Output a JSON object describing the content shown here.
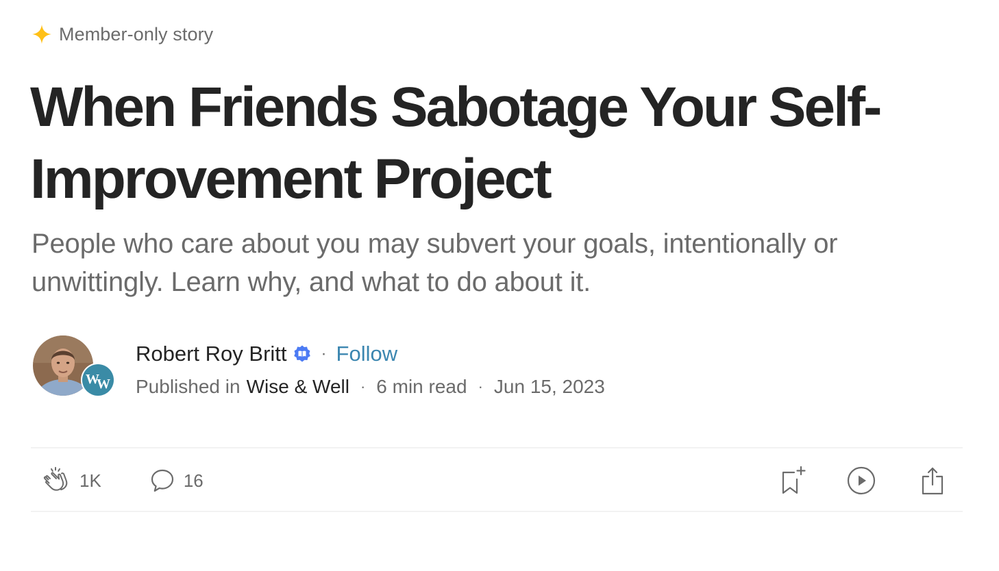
{
  "member_badge": {
    "icon": "sparkle-star-icon",
    "label": "Member-only story",
    "star_color": "#FFC017"
  },
  "article": {
    "title": "When Friends Sabotage Your Self-Improvement Project",
    "subtitle": "People who care about you may subvert your goals, intentionally or unwittingly. Learn why, and what to do about it."
  },
  "author": {
    "name": "Robert Roy Britt",
    "verified_icon": "verified-badge-icon",
    "follow_label": "Follow",
    "avatar_icon": "author-avatar",
    "separator": "·"
  },
  "publication": {
    "prefix": "Published in",
    "name": "Wise & Well",
    "badge_text": "WW",
    "read_time": "6 min read",
    "date": "Jun 15, 2023",
    "separator": "·"
  },
  "actions": {
    "claps": "1K",
    "comments": "16",
    "clap_icon": "clap-icon",
    "comment_icon": "comment-icon",
    "bookmark_icon": "bookmark-add-icon",
    "listen_icon": "play-icon",
    "share_icon": "share-icon"
  },
  "colors": {
    "text_primary": "#242424",
    "text_secondary": "#6B6B6B",
    "follow_link": "#3B86B0",
    "verified": "#4C7BF4",
    "publication_badge": "#3A8BA6"
  }
}
